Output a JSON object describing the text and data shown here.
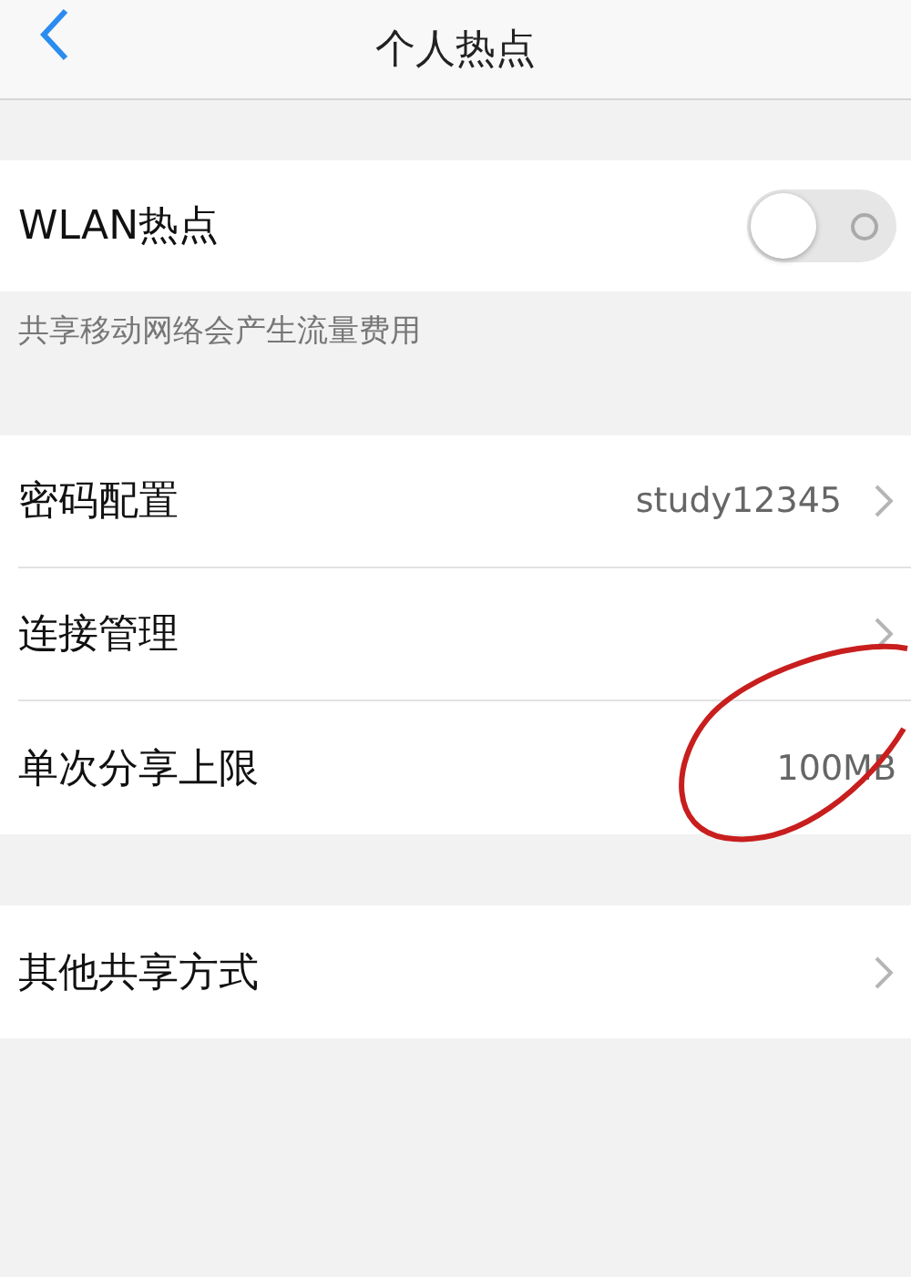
{
  "header": {
    "title": "个人热点"
  },
  "hotspot": {
    "label": "WLAN热点",
    "on": false
  },
  "note": "共享移动网络会产生流量费用",
  "groups": [
    [
      {
        "label": "密码配置",
        "value": "study12345"
      },
      {
        "label": "连接管理"
      },
      {
        "label": "单次分享上限",
        "value": "100MB",
        "chevron_hidden": true
      }
    ],
    [
      {
        "label": "其他共享方式"
      }
    ]
  ]
}
